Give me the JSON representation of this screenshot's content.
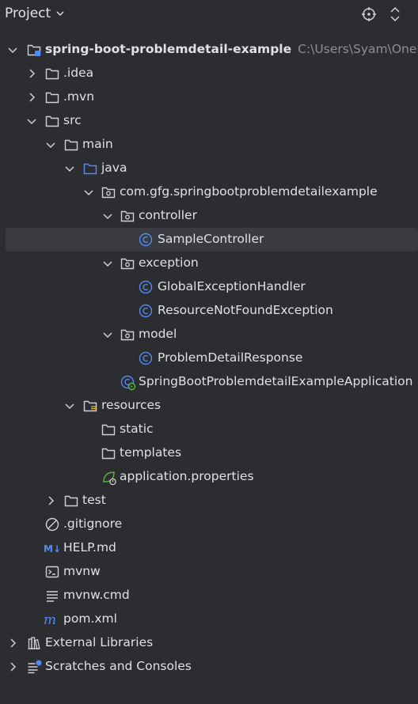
{
  "header": {
    "title": "Project"
  },
  "tree": {
    "root": {
      "name": "spring-boot-problemdetail-example",
      "path": "C:\\Users\\Syam\\OneD"
    },
    "idea": ".idea",
    "mvn": ".mvn",
    "src": "src",
    "main": "main",
    "java": "java",
    "package": "com.gfg.springbootproblemdetailexample",
    "controller": "controller",
    "sample_controller": "SampleController",
    "exception": "exception",
    "global_handler": "GlobalExceptionHandler",
    "resource_not_found": "ResourceNotFoundException",
    "model": "model",
    "problem_detail_response": "ProblemDetailResponse",
    "application_class": "SpringBootProblemdetailExampleApplication",
    "resources": "resources",
    "static": "static",
    "templates": "templates",
    "application_properties": "application.properties",
    "test": "test",
    "gitignore": ".gitignore",
    "help_md": "HELP.md",
    "mvnw": "mvnw",
    "mvnw_cmd": "mvnw.cmd",
    "pom": "pom.xml",
    "external_libraries": "External Libraries",
    "scratches": "Scratches and Consoles"
  },
  "colors": {
    "background": "#2b2d30",
    "selection": "#393b40",
    "text": "#dfe1e5",
    "muted": "#8c8f94",
    "class_icon": "#548af7",
    "spring": "#5fb832"
  }
}
